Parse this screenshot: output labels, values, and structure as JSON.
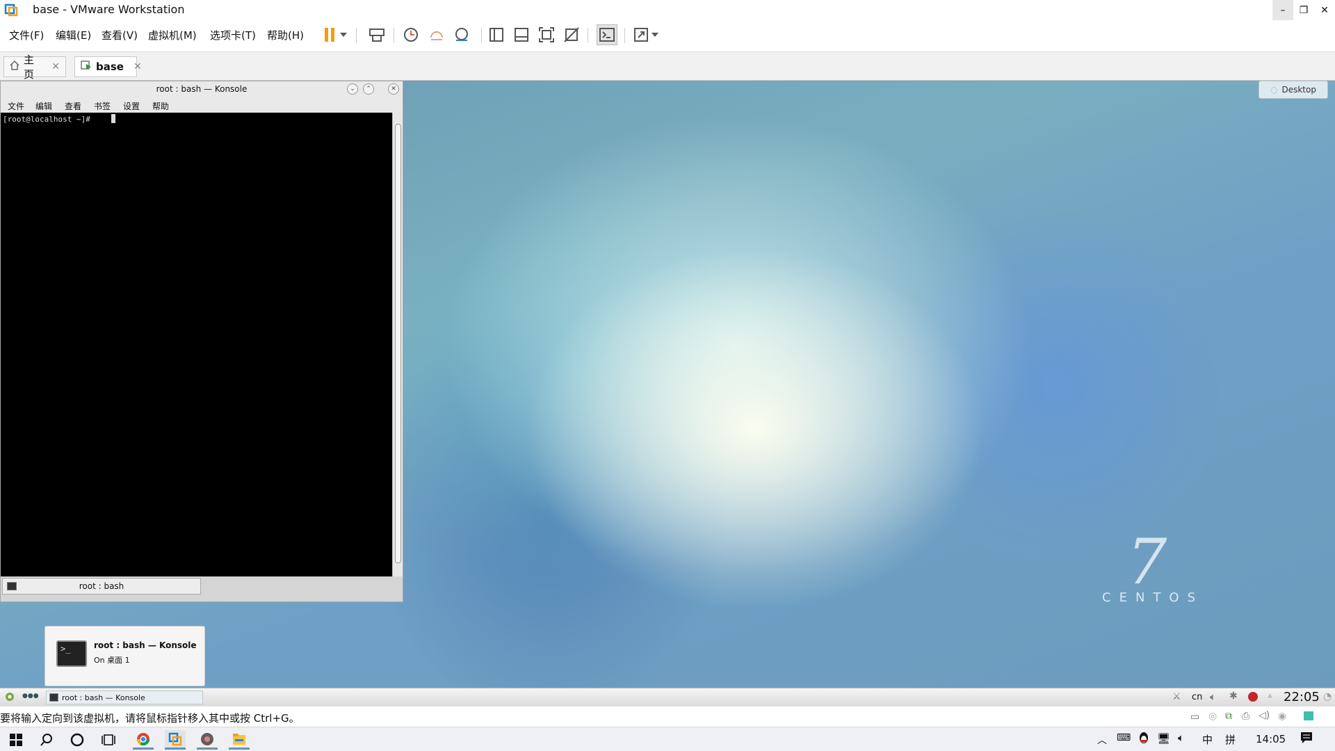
{
  "window": {
    "title": "base - VMware Workstation",
    "controls": {
      "minimize": "–",
      "restore": "❐",
      "close": "✕"
    }
  },
  "menu": {
    "file": "文件(F)",
    "edit": "编辑(E)",
    "view": "查看(V)",
    "vm": "虚拟机(M)",
    "tabs": "选项卡(T)",
    "help": "帮助(H)"
  },
  "toolbar": {
    "icons": [
      "pause-icon",
      "dropdown-arrow-icon",
      "send-ctrl-alt-del-icon",
      "snapshot-icon",
      "revert-snapshot-icon",
      "snapshot-manager-icon",
      "show-library-icon",
      "show-thumbnail-icon",
      "full-screen-icon",
      "unity-icon",
      "console-view-icon",
      "stretch-icon",
      "dropdown-arrow-icon"
    ]
  },
  "tabs": [
    {
      "label": "主页",
      "active": false
    },
    {
      "label": "base",
      "active": true
    }
  ],
  "guest": {
    "desktop_button": "Desktop",
    "konsole": {
      "title": "root : bash — Konsole",
      "menu": [
        "文件",
        "编辑",
        "查看",
        "书签",
        "设置",
        "帮助"
      ],
      "prompt": "[root@localhost ~]#",
      "tab_label": "root : bash"
    },
    "notification": {
      "title": "root : bash — Konsole",
      "subtitle": "On 桌面 1"
    },
    "logo": {
      "number": "7",
      "text": "CENTOS"
    },
    "taskbar": {
      "task_label": "root : bash — Konsole",
      "clock": "22:05",
      "tray_text": "cn"
    }
  },
  "statusbar": {
    "message": "要将输入定向到该虚拟机，请将鼠标指针移入其中或按 Ctrl+G。"
  },
  "host_taskbar": {
    "time": "14:05",
    "ime_lang": "中",
    "ime_mode": "拼",
    "app_icons": [
      "windows-start-icon",
      "search-icon",
      "cortana-icon",
      "task-view-icon",
      "chrome-icon",
      "vmware-icon",
      "media-icon",
      "file-explorer-icon"
    ]
  },
  "colors": {
    "accent": "#f39c12",
    "terminal_bg": "#000000",
    "taskbar_indicator": "#6a8fb0"
  }
}
